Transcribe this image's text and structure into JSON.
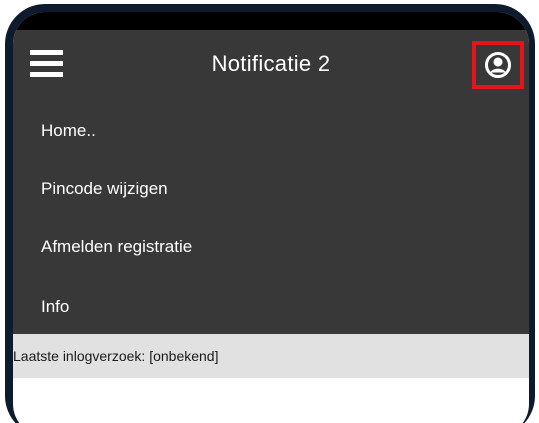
{
  "appbar": {
    "title": "Notificatie 2",
    "menu_icon": "hamburger-menu-icon",
    "profile_icon": "user-circle-icon"
  },
  "menu": {
    "items": [
      {
        "label": "Home.."
      },
      {
        "label": "Pincode wijzigen"
      },
      {
        "label": "Afmelden registratie"
      },
      {
        "label": "Info"
      }
    ]
  },
  "footer": {
    "text": "Laatste inlogverzoek: [onbekend]"
  },
  "colors": {
    "bezel": "#0e1a2e",
    "appbar": "#383838",
    "highlight": "#e3141b",
    "footer": "#e1e1e1"
  }
}
